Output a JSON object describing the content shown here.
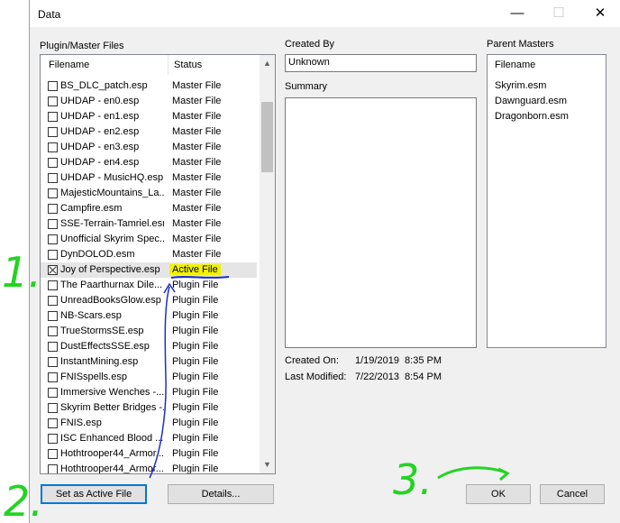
{
  "window": {
    "title": "Data",
    "min_glyph": "—",
    "max_glyph": "☐",
    "close_glyph": "✕"
  },
  "plugin_list": {
    "section_label": "Plugin/Master Files",
    "col_filename": "Filename",
    "col_status": "Status",
    "rows": [
      {
        "name": "BS_DLC_patch.esp",
        "status": "Master File",
        "checked": false
      },
      {
        "name": "UHDAP - en0.esp",
        "status": "Master File",
        "checked": false
      },
      {
        "name": "UHDAP - en1.esp",
        "status": "Master File",
        "checked": false
      },
      {
        "name": "UHDAP - en2.esp",
        "status": "Master File",
        "checked": false
      },
      {
        "name": "UHDAP - en3.esp",
        "status": "Master File",
        "checked": false
      },
      {
        "name": "UHDAP - en4.esp",
        "status": "Master File",
        "checked": false
      },
      {
        "name": "UHDAP - MusicHQ.esp",
        "status": "Master File",
        "checked": false
      },
      {
        "name": "MajesticMountains_La...",
        "status": "Master File",
        "checked": false
      },
      {
        "name": "Campfire.esm",
        "status": "Master File",
        "checked": false
      },
      {
        "name": "SSE-Terrain-Tamriel.esm",
        "status": "Master File",
        "checked": false
      },
      {
        "name": "Unofficial Skyrim Spec...",
        "status": "Master File",
        "checked": false
      },
      {
        "name": "DynDOLOD.esm",
        "status": "Master File",
        "checked": false
      },
      {
        "name": "Joy of Perspective.esp",
        "status": "Active File",
        "checked": true,
        "selected": true
      },
      {
        "name": "The Paarthurnax Dile...",
        "status": "Plugin File",
        "checked": false
      },
      {
        "name": "UnreadBooksGlow.esp",
        "status": "Plugin File",
        "checked": false
      },
      {
        "name": "NB-Scars.esp",
        "status": "Plugin File",
        "checked": false
      },
      {
        "name": "TrueStormsSE.esp",
        "status": "Plugin File",
        "checked": false
      },
      {
        "name": "DustEffectsSSE.esp",
        "status": "Plugin File",
        "checked": false
      },
      {
        "name": "InstantMining.esp",
        "status": "Plugin File",
        "checked": false
      },
      {
        "name": "FNISspells.esp",
        "status": "Plugin File",
        "checked": false
      },
      {
        "name": "Immersive Wenches -...",
        "status": "Plugin File",
        "checked": false
      },
      {
        "name": "Skyrim Better Bridges -...",
        "status": "Plugin File",
        "checked": false
      },
      {
        "name": "FNIS.esp",
        "status": "Plugin File",
        "checked": false
      },
      {
        "name": "ISC Enhanced Blood ...",
        "status": "Plugin File",
        "checked": false
      },
      {
        "name": "Hothtrooper44_Armor...",
        "status": "Plugin File",
        "checked": false
      },
      {
        "name": "Hothtrooper44_Armor...",
        "status": "Plugin File",
        "checked": false
      }
    ],
    "scroll_up": "▲",
    "scroll_down": "▼"
  },
  "details": {
    "created_by_label": "Created By",
    "created_by_value": "Unknown",
    "summary_label": "Summary",
    "summary_value": "",
    "created_on_label": "Created On:",
    "created_on_value": "1/19/2019  8:35 PM",
    "last_modified_label": "Last Modified:",
    "last_modified_value": "7/22/2013  8:54 PM"
  },
  "parent_masters": {
    "section_label": "Parent Masters",
    "col_filename": "Filename",
    "items": [
      "Skyrim.esm",
      "Dawnguard.esm",
      "Dragonborn.esm"
    ]
  },
  "buttons": {
    "set_active": "Set as Active File",
    "details": "Details...",
    "ok": "OK",
    "cancel": "Cancel"
  },
  "annotations": {
    "one": "1.",
    "two": "2.",
    "three": "3.",
    "ink_green": "#22d422",
    "ink_blue": "#1a2fc8",
    "highlight": "#f2f200"
  },
  "colors": {
    "focus_border": "#0078d7",
    "selection": "#e5e5e5",
    "dialog_bg": "#f0f0f0"
  }
}
